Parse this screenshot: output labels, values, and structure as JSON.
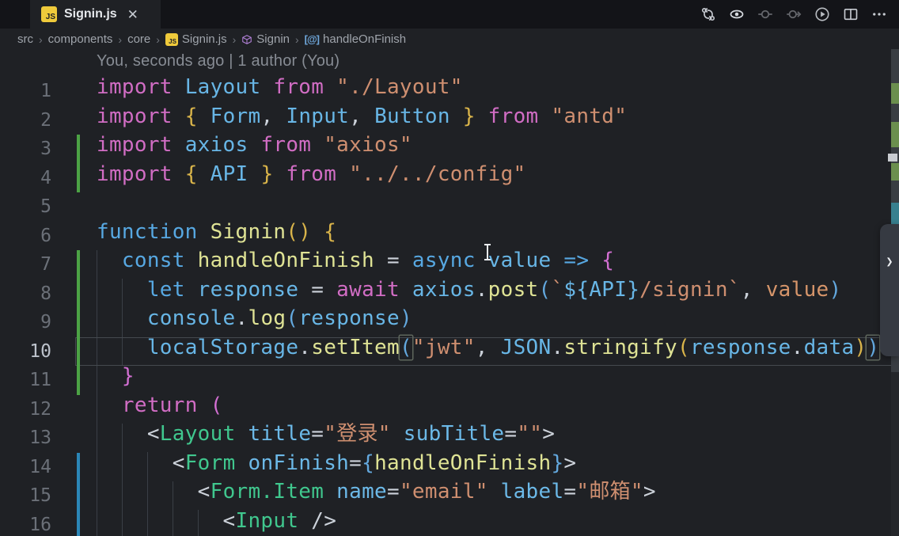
{
  "window": {
    "tab": {
      "label": "Signin.js",
      "close_glyph": "✕",
      "file_icon": "js"
    },
    "editor_actions": [
      "compare-changes",
      "watch-eye",
      "step-circle-left",
      "step-circle-right",
      "run-code",
      "split-editor",
      "more-actions"
    ]
  },
  "breadcrumb": {
    "items": [
      {
        "label": "src",
        "icon": null
      },
      {
        "label": "components",
        "icon": null
      },
      {
        "label": "core",
        "icon": null
      },
      {
        "label": "Signin.js",
        "icon": "js"
      },
      {
        "label": "Signin",
        "icon": "class"
      },
      {
        "label": "handleOnFinish",
        "icon": "method"
      }
    ],
    "separator": "›"
  },
  "codelens": {
    "text": "You, seconds ago | 1 author (You)"
  },
  "overlay": {
    "chevron": "❯"
  },
  "colors": {
    "keyword_pink": "#d16dc4",
    "keyword_blue": "#57a8e2",
    "identifier": "#68b6e6",
    "function": "#dfe395",
    "string": "#cf8f70",
    "bracket1_gold": "#d9b44a",
    "bracket2_orchid": "#d26fd2",
    "bracket3_blue": "#63a8de",
    "jsx_tag": "#40c78e",
    "gutter_added": "#4ca345",
    "gutter_modified": "#2b87b8",
    "background": "#1f2125"
  },
  "editor": {
    "lines": [
      {
        "num": 1,
        "gutter": null,
        "current": false,
        "tokens": [
          [
            "kwp",
            "import "
          ],
          [
            "id",
            "Layout"
          ],
          [
            "kwp",
            " from "
          ],
          [
            "str",
            "\"./Layout\""
          ]
        ]
      },
      {
        "num": 2,
        "gutter": null,
        "current": false,
        "tokens": [
          [
            "kwp",
            "import "
          ],
          [
            "b1",
            "{ "
          ],
          [
            "id",
            "Form"
          ],
          [
            "pn",
            ", "
          ],
          [
            "id",
            "Input"
          ],
          [
            "pn",
            ", "
          ],
          [
            "id",
            "Button"
          ],
          [
            "b1",
            " }"
          ],
          [
            "kwp",
            " from "
          ],
          [
            "str",
            "\"antd\""
          ]
        ]
      },
      {
        "num": 3,
        "gutter": "added",
        "current": false,
        "tokens": [
          [
            "kwp",
            "import "
          ],
          [
            "id",
            "axios"
          ],
          [
            "kwp",
            " from "
          ],
          [
            "str",
            "\"axios\""
          ]
        ]
      },
      {
        "num": 4,
        "gutter": "added",
        "current": false,
        "tokens": [
          [
            "kwp",
            "import "
          ],
          [
            "b1",
            "{ "
          ],
          [
            "id",
            "API"
          ],
          [
            "b1",
            " }"
          ],
          [
            "kwp",
            " from "
          ],
          [
            "str",
            "\"../../config\""
          ]
        ]
      },
      {
        "num": 5,
        "gutter": null,
        "current": false,
        "tokens": []
      },
      {
        "num": 6,
        "gutter": null,
        "current": false,
        "tokens": [
          [
            "kwb",
            "function "
          ],
          [
            "fn",
            "Signin"
          ],
          [
            "b1",
            "()"
          ],
          [
            "pn",
            " "
          ],
          [
            "b1",
            "{"
          ]
        ]
      },
      {
        "num": 7,
        "gutter": "added",
        "current": false,
        "tokens": [
          [
            "pn",
            "  "
          ],
          [
            "kwb",
            "const "
          ],
          [
            "fn",
            "handleOnFinish"
          ],
          [
            "pn",
            " = "
          ],
          [
            "kwb",
            "async "
          ],
          [
            "id",
            "value"
          ],
          [
            "kwb",
            " => "
          ],
          [
            "b2",
            "{"
          ]
        ]
      },
      {
        "num": 8,
        "gutter": "added",
        "current": false,
        "tokens": [
          [
            "pn",
            "    "
          ],
          [
            "kwb",
            "let "
          ],
          [
            "id",
            "response"
          ],
          [
            "pn",
            " = "
          ],
          [
            "kwp",
            "await "
          ],
          [
            "id",
            "axios"
          ],
          [
            "pn",
            "."
          ],
          [
            "fn",
            "post"
          ],
          [
            "b3",
            "("
          ],
          [
            "str",
            "`"
          ],
          [
            "id",
            "${API}"
          ],
          [
            "str",
            "/signin`"
          ],
          [
            "pn",
            ", "
          ],
          [
            "par",
            "value"
          ],
          [
            "b3",
            ")"
          ]
        ]
      },
      {
        "num": 9,
        "gutter": "added",
        "current": false,
        "tokens": [
          [
            "pn",
            "    "
          ],
          [
            "id",
            "console"
          ],
          [
            "pn",
            "."
          ],
          [
            "fn",
            "log"
          ],
          [
            "b3",
            "("
          ],
          [
            "id",
            "response"
          ],
          [
            "b3",
            ")"
          ]
        ]
      },
      {
        "num": 10,
        "gutter": "added",
        "current": true,
        "tokens": [
          [
            "pn",
            "    "
          ],
          [
            "id",
            "localStorage"
          ],
          [
            "pn",
            "."
          ],
          [
            "fn",
            "setItem"
          ],
          [
            "b3",
            "(",
            "box"
          ],
          [
            "str",
            "\"jwt\""
          ],
          [
            "pn",
            ", "
          ],
          [
            "id",
            "JSON"
          ],
          [
            "pn",
            "."
          ],
          [
            "fn",
            "stringify"
          ],
          [
            "b1",
            "("
          ],
          [
            "id",
            "response"
          ],
          [
            "pn",
            "."
          ],
          [
            "id",
            "data"
          ],
          [
            "b1",
            ")"
          ],
          [
            "b3",
            ")",
            "box"
          ]
        ]
      },
      {
        "num": 11,
        "gutter": "added",
        "current": false,
        "tokens": [
          [
            "pn",
            "  "
          ],
          [
            "b2",
            "}"
          ]
        ]
      },
      {
        "num": 12,
        "gutter": null,
        "current": false,
        "tokens": [
          [
            "pn",
            "  "
          ],
          [
            "kwp",
            "return "
          ],
          [
            "b2",
            "("
          ]
        ]
      },
      {
        "num": 13,
        "gutter": null,
        "current": false,
        "tokens": [
          [
            "pn",
            "    "
          ],
          [
            "pn",
            "<"
          ],
          [
            "jsx",
            "Layout"
          ],
          [
            "pn",
            " "
          ],
          [
            "attr",
            "title"
          ],
          [
            "pn",
            "="
          ],
          [
            "str",
            "\"登录\""
          ],
          [
            "pn",
            " "
          ],
          [
            "attr",
            "subTitle"
          ],
          [
            "pn",
            "="
          ],
          [
            "str",
            "\"\""
          ],
          [
            "pn",
            ">"
          ]
        ]
      },
      {
        "num": 14,
        "gutter": "modified",
        "current": false,
        "tokens": [
          [
            "pn",
            "      "
          ],
          [
            "pn",
            "<"
          ],
          [
            "jsx",
            "Form"
          ],
          [
            "pn",
            " "
          ],
          [
            "attr",
            "onFinish"
          ],
          [
            "pn",
            "="
          ],
          [
            "b3",
            "{"
          ],
          [
            "fn",
            "handleOnFinish"
          ],
          [
            "b3",
            "}"
          ],
          [
            "pn",
            ">"
          ]
        ]
      },
      {
        "num": 15,
        "gutter": "modified",
        "current": false,
        "tokens": [
          [
            "pn",
            "        "
          ],
          [
            "pn",
            "<"
          ],
          [
            "jsx",
            "Form.Item"
          ],
          [
            "pn",
            " "
          ],
          [
            "attr",
            "name"
          ],
          [
            "pn",
            "="
          ],
          [
            "str",
            "\"email\""
          ],
          [
            "pn",
            " "
          ],
          [
            "attr",
            "label"
          ],
          [
            "pn",
            "="
          ],
          [
            "str",
            "\"邮箱\""
          ],
          [
            "pn",
            ">"
          ]
        ]
      },
      {
        "num": 16,
        "gutter": "modified",
        "current": false,
        "tokens": [
          [
            "pn",
            "          "
          ],
          [
            "pn",
            "<"
          ],
          [
            "jsx",
            "Input"
          ],
          [
            "pn",
            " />"
          ]
        ]
      }
    ]
  }
}
